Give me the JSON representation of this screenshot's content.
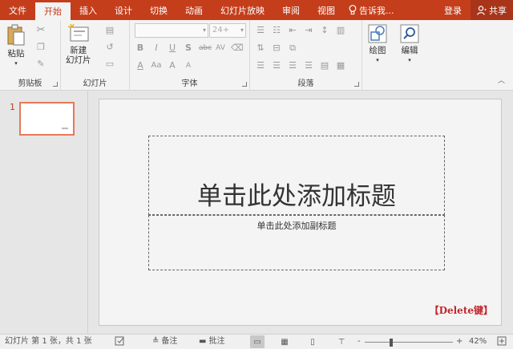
{
  "tabs": {
    "file": "文件",
    "home": "开始",
    "insert": "插入",
    "design": "设计",
    "transitions": "切换",
    "animations": "动画",
    "slideshow": "幻灯片放映",
    "review": "审阅",
    "view": "视图",
    "tellme": "告诉我...",
    "signin": "登录",
    "share": "共享"
  },
  "ribbon": {
    "clipboard": {
      "label": "剪贴板",
      "paste": "粘贴"
    },
    "slides": {
      "label": "幻灯片",
      "new_slide_line1": "新建",
      "new_slide_line2": "幻灯片"
    },
    "font": {
      "label": "字体",
      "size": "24+"
    },
    "paragraph": {
      "label": "段落"
    },
    "drawing": {
      "label": "绘图"
    },
    "editing": {
      "label": "编辑"
    }
  },
  "thumbnails": {
    "number": "1"
  },
  "slide": {
    "title_placeholder": "单击此处添加标题",
    "subtitle_placeholder": "单击此处添加副标题",
    "annotation": "【Delete键】"
  },
  "status": {
    "slide_info": "幻灯片 第 1 张，共 1 张",
    "notes": "备注",
    "comments": "批注",
    "zoom_minus": "-",
    "zoom_plus": "+",
    "zoom": "42%",
    "zoom_fraction": 0.3
  },
  "colors": {
    "accent": "#c43e1c",
    "annotation": "#c0282e"
  }
}
